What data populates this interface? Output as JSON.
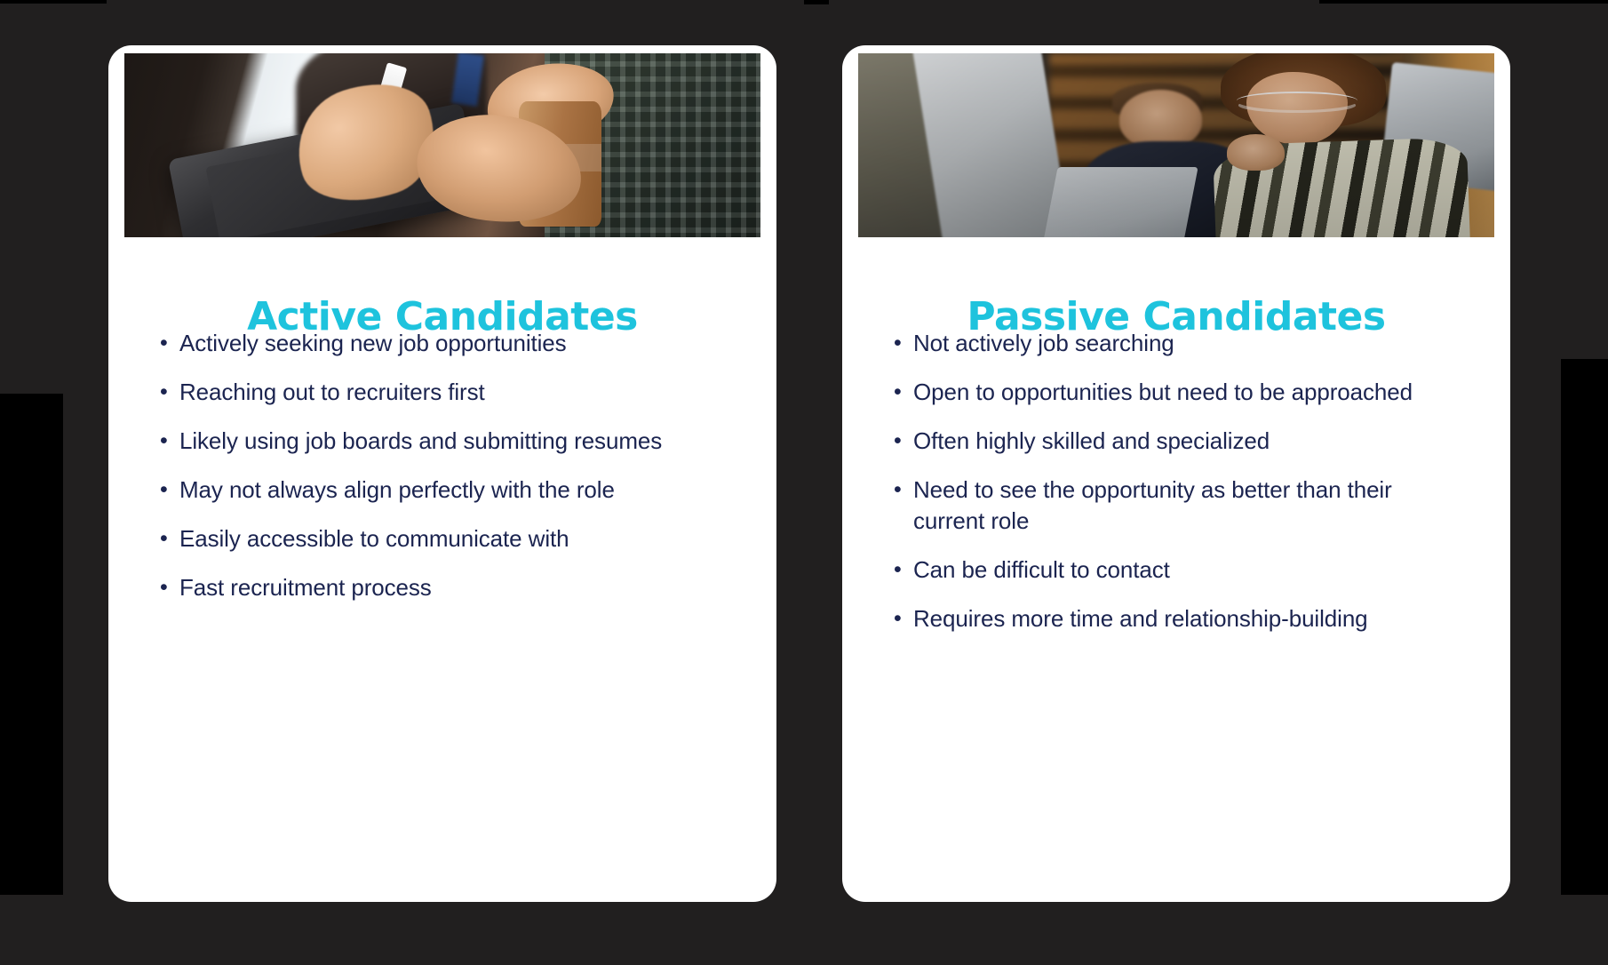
{
  "theme": {
    "page_background": "#211f1f",
    "patch_color": "#000000",
    "card_background": "#ffffff",
    "title_color": "#1ec3dd",
    "body_text_color": "#1b2450",
    "bullet_glyph": "•"
  },
  "cards": [
    {
      "id": "active-candidates",
      "title": "Active Candidates",
      "image_alt": "two-people-reviewing-tablet-photo",
      "bullets": [
        "Actively seeking new job opportunities",
        "Reaching out to recruiters first",
        "Likely using job boards and submitting resumes",
        "May not always align perfectly with the role",
        "Easily accessible to communicate with",
        "Fast recruitment process"
      ]
    },
    {
      "id": "passive-candidates",
      "title": "Passive Candidates",
      "image_alt": "office-coworkers-at-laptops-photo",
      "bullets": [
        "Not actively job searching",
        "Open to opportunities but need to be approached",
        "Often highly skilled and specialized",
        "Need to see the opportunity as better than their current role",
        "Can be difficult to contact",
        "Requires more time and relationship-building"
      ]
    }
  ]
}
